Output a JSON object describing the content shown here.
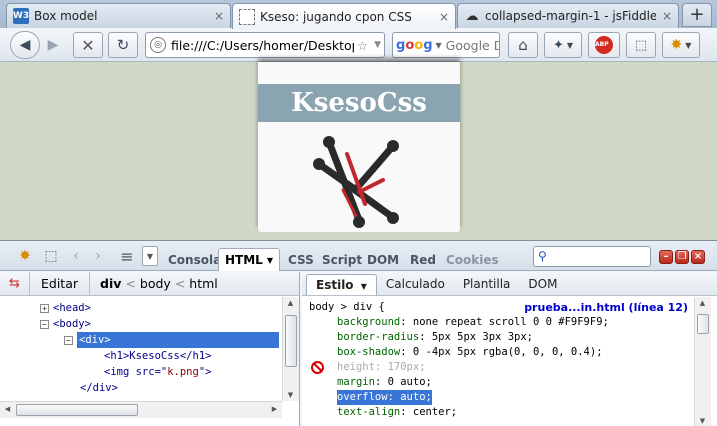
{
  "tabs": [
    {
      "title": "Box model",
      "favicon": "w3-icon",
      "active": false
    },
    {
      "title": "Kseso: jugando cpon CSS",
      "favicon": "blank-page-icon",
      "active": true
    },
    {
      "title": "collapsed-margin-1 - jsFiddle",
      "favicon": "cloud-icon",
      "active": false
    }
  ],
  "tab_close": "×",
  "new_tab": "+",
  "nav": {
    "url": "file:///C:/Users/homer/Desktop/",
    "search_placeholder": "Google De",
    "search_engine": "Google"
  },
  "page": {
    "heading": "KsesoCss",
    "image_alt": "k.png logo",
    "logo_colors": {
      "dark": "#2a2a2a",
      "red": "#c0282c"
    }
  },
  "firebug": {
    "panels": [
      "Consola",
      "HTML",
      "CSS",
      "Script",
      "DOM",
      "Red",
      "Cookies"
    ],
    "active_panel": "HTML",
    "edit_label": "Editar",
    "breadcrumb": [
      "div",
      "body",
      "html"
    ],
    "tree": [
      {
        "indent": 0,
        "toggle": "+",
        "html": "<head>"
      },
      {
        "indent": 0,
        "toggle": "−",
        "html": "<body>"
      },
      {
        "indent": 1,
        "toggle": "−",
        "html": "<div>",
        "selected": true
      },
      {
        "indent": 2,
        "toggle": "",
        "html": "<h1>KsesoCss</h1>"
      },
      {
        "indent": 2,
        "toggle": "",
        "html_tag": "<img src=\"",
        "attr_value": "k.png",
        "html_end": "\">"
      },
      {
        "indent": 1,
        "toggle": "",
        "html": "</div>"
      }
    ],
    "side_tabs": [
      "Estilo",
      "Calculado",
      "Plantilla",
      "DOM"
    ],
    "active_side_tab": "Estilo",
    "selector": "body > div {",
    "source_link": "prueba...in.html (línea 12)",
    "rules": [
      {
        "prop": "background",
        "value": "none repeat scroll 0 0 #F9F9F9;",
        "state": "normal"
      },
      {
        "prop": "border-radius",
        "value": "5px 5px 3px 3px;",
        "state": "normal"
      },
      {
        "prop": "box-shadow",
        "value": "0 -4px 5px rgba(0, 0, 0, 0.4);",
        "state": "normal"
      },
      {
        "prop": "height",
        "value": "170px;",
        "state": "disabled"
      },
      {
        "prop": "margin",
        "value": "0 auto;",
        "state": "normal"
      },
      {
        "prop": "overflow",
        "value": "auto;",
        "state": "selected"
      },
      {
        "prop": "text-align",
        "value": "center;",
        "state": "normal"
      }
    ]
  },
  "colors": {
    "accent": "#3875d7",
    "page_bg": "#cfd9c5",
    "heading_bg": "#8aa5b1"
  }
}
